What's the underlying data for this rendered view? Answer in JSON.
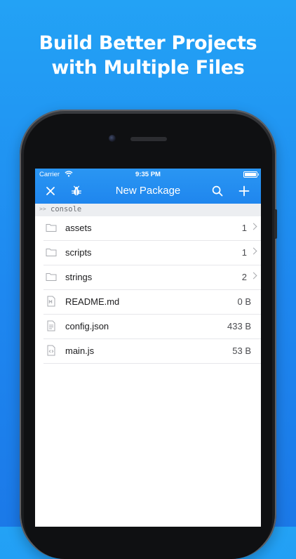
{
  "headline": {
    "line1": "Build Better Projects",
    "line2": "with Multiple Files"
  },
  "status_bar": {
    "carrier": "Carrier",
    "time": "9:35 PM"
  },
  "navbar": {
    "title": "New Package",
    "left_icons": [
      "close-icon",
      "bug-icon"
    ],
    "right_icons": [
      "search-icon",
      "add-icon"
    ],
    "accent_color": "#1f86ee"
  },
  "console": {
    "prompt": ">>",
    "label": "console"
  },
  "files": [
    {
      "name": "assets",
      "meta": "1",
      "type": "folder"
    },
    {
      "name": "scripts",
      "meta": "1",
      "type": "folder"
    },
    {
      "name": "strings",
      "meta": "2",
      "type": "folder"
    },
    {
      "name": "README.md",
      "meta": "0 B",
      "type": "markdown"
    },
    {
      "name": "config.json",
      "meta": "433 B",
      "type": "json"
    },
    {
      "name": "main.js",
      "meta": "53 B",
      "type": "code"
    }
  ]
}
